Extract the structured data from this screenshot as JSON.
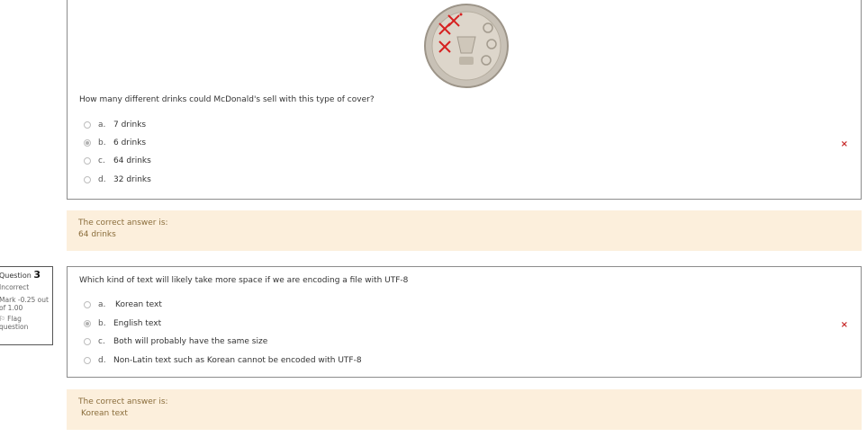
{
  "question2": {
    "text": "How many different drinks could McDonald's sell with this type of cover?",
    "options": [
      {
        "letter": "a.",
        "label": "7 drinks"
      },
      {
        "letter": "b.",
        "label": "6 drinks"
      },
      {
        "letter": "c.",
        "label": "64 drinks"
      },
      {
        "letter": "d.",
        "label": "32 drinks"
      }
    ],
    "selected_index": 1,
    "result_icon": "×",
    "feedback_title": "The correct answer is:",
    "feedback_answer": "64 drinks"
  },
  "question3": {
    "info": {
      "question_label": "Question",
      "question_number": "3",
      "status": "Incorrect",
      "mark_line1": "Mark -0.25 out",
      "mark_line2": "of 1.00",
      "flag_line1": "Flag",
      "flag_line2": "question"
    },
    "text": "Which kind of text will likely take more space if we are encoding a file with UTF-8",
    "options": [
      {
        "letter": "a.",
        "label": "Korean text"
      },
      {
        "letter": "b.",
        "label": "English text"
      },
      {
        "letter": "c.",
        "label": "Both will probably have the same size"
      },
      {
        "letter": "d.",
        "label": "Non-Latin text such as Korean cannot be encoded with UTF-8"
      }
    ],
    "selected_index": 1,
    "result_icon": "×",
    "feedback_title": "The correct answer is:",
    "feedback_answer": "Korean text"
  },
  "colors": {
    "feedback_bg": "#fcefdc",
    "feedback_text": "#8a6d3b",
    "incorrect": "#c62828",
    "border": "#8c8c8c"
  }
}
